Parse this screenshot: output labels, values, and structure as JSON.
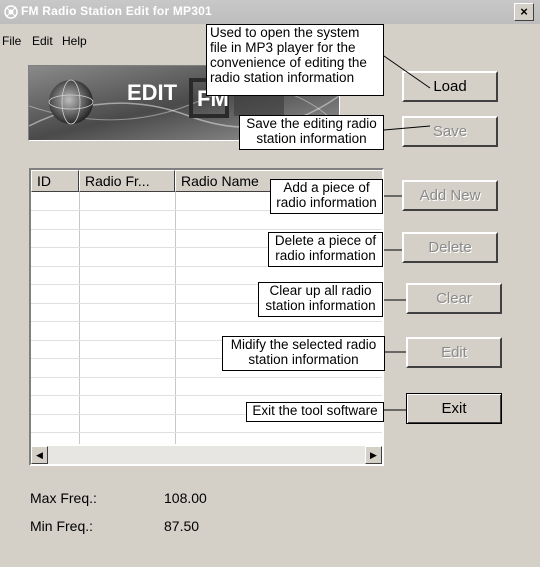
{
  "window": {
    "title": "FM Radio Station Edit for MP301",
    "close_glyph": "×"
  },
  "menu": {
    "items": [
      "File",
      "Edit",
      "Help"
    ]
  },
  "banner": {
    "text": "EDIT",
    "text2": "FM"
  },
  "buttons": {
    "load": "Load",
    "save": "Save",
    "add_new": "Add New",
    "delete": "Delete",
    "clear": "Clear",
    "edit": "Edit",
    "exit": "Exit"
  },
  "table": {
    "columns": [
      "ID",
      "Radio Fr...",
      "Radio Name"
    ],
    "rows": []
  },
  "scrollbar": {
    "left_glyph": "◀",
    "right_glyph": "▶"
  },
  "stats": {
    "max_label": "Max Freq.:",
    "max_value": "108.00",
    "min_label": "Min Freq.:",
    "min_value": "87.50"
  },
  "callouts": {
    "load": [
      "Used to open the system",
      "file in MP3 player for the",
      "convenience of editing the",
      "radio station information"
    ],
    "save": [
      "Save the editing radio",
      "station information"
    ],
    "add_new": [
      "Add a piece of",
      "radio information"
    ],
    "delete": [
      "Delete a piece of",
      "radio information"
    ],
    "clear": [
      "Clear up all radio",
      "station information"
    ],
    "edit": [
      "Midify the selected radio",
      "station information"
    ],
    "exit": [
      "Exit the tool software"
    ]
  }
}
